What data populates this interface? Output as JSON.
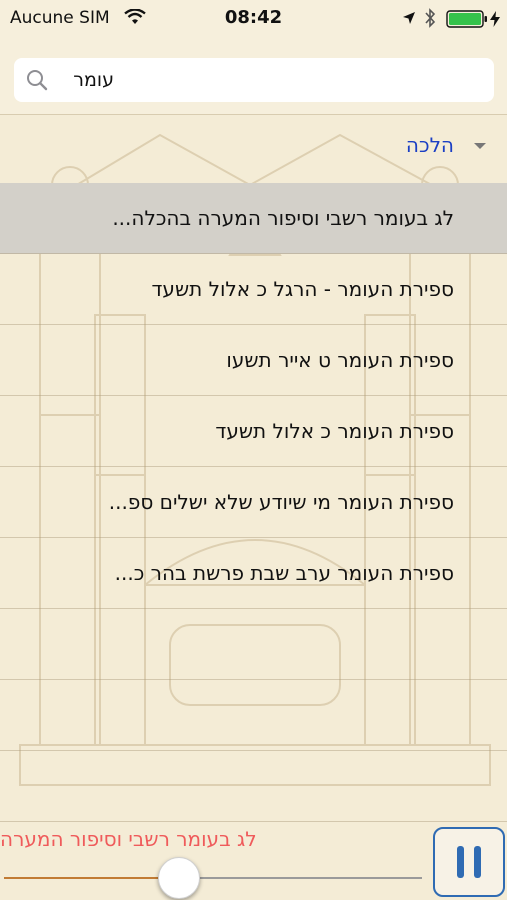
{
  "status_bar": {
    "carrier": "Aucune SIM",
    "time": "08:42",
    "icons": [
      "wifi-icon",
      "location-arrow-icon",
      "bluetooth-icon",
      "battery-icon",
      "charging-icon"
    ]
  },
  "search": {
    "value": "עומר",
    "icon": "search-icon"
  },
  "section": {
    "label": "הלכה",
    "icon": "chevron-down-icon"
  },
  "results": [
    "לג בעומר רשבי וסיפור המערה בהכלה...",
    "ספירת העומר - הרגל כ אלול תשעד",
    "ספירת העומר ט אייר תשעו",
    "ספירת העומר כ אלול תשעד",
    "ספירת העומר מי שיודע שלא ישלים ספ...",
    "ספירת העומר ערב שבת פרשת בהר כ..."
  ],
  "player": {
    "now_playing": "לג בעומר רשבי וסיפור המערה",
    "progress": 0.42,
    "pause_icon": "pause-icon"
  },
  "colors": {
    "background": "#f4ecd6",
    "section_label": "#1b3fc4",
    "selected_row": "#d3d0c9",
    "now_playing": "#ef5b5b",
    "progress_played": "#c17b34",
    "pause_button_border": "#2f6bb3"
  }
}
